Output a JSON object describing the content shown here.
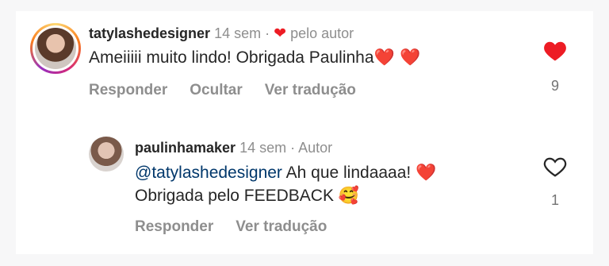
{
  "comments": [
    {
      "username": "tatylashedesigner",
      "time": "14 sem",
      "separator": "·",
      "author_badge": "pelo autor",
      "text": "Ameiiiii muito lindo! Obrigada Paulinha",
      "text_emojis": "❤️ ❤️",
      "actions": [
        "Responder",
        "Ocultar",
        "Ver tradução"
      ],
      "likes": "9",
      "liked": true
    }
  ],
  "reply": {
    "username": "paulinhamaker",
    "time": "14 sem",
    "separator": "·",
    "author_label": "Autor",
    "mention": "@tatylashedesigner",
    "text_line1": " Ah que lindaaaa!",
    "text_line2": "Obrigada pelo FEEDBACK",
    "emoji_heart": "❤️",
    "emoji_face": "🥰",
    "actions": [
      "Responder",
      "Ver tradução"
    ],
    "likes": "1",
    "liked": false
  },
  "icons": {
    "heart_filled": "heart-filled-icon",
    "heart_outline": "heart-outline-icon"
  },
  "colors": {
    "like_red": "#ed1c24",
    "mention_blue": "#00376b",
    "muted_gray": "#8e8e8e"
  }
}
